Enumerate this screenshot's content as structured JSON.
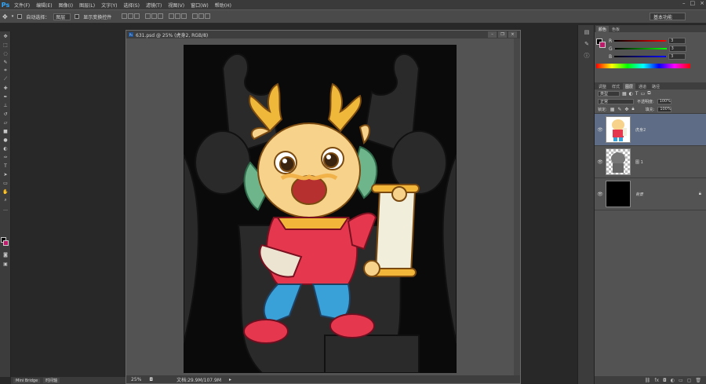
{
  "menubar": {
    "app_logo": "Ps",
    "items": [
      "文件(F)",
      "编辑(E)",
      "图像(I)",
      "图层(L)",
      "文字(Y)",
      "选择(S)",
      "滤镜(T)",
      "视图(V)",
      "窗口(W)",
      "帮助(H)"
    ],
    "controls": [
      "–",
      "□",
      "×"
    ]
  },
  "options": {
    "auto_select_label": "自动选择：",
    "auto_select_value": "图层",
    "transform_label": "显示变换控件",
    "workspace": "基本功能"
  },
  "document": {
    "title": "631.psd @ 25% (虎身2, RGB/8)",
    "zoom": "25%",
    "doc_size": "文档:29.9M/107.9M"
  },
  "mini_bridge": {
    "tabs": [
      "Mini Bridge",
      "时间轴"
    ]
  },
  "color_panel": {
    "tabs": [
      "颜色",
      "色板"
    ],
    "channels": [
      {
        "label": "R",
        "value": "3",
        "color": "#ff3b3b"
      },
      {
        "label": "G",
        "value": "3",
        "color": "#3bd03b"
      },
      {
        "label": "B",
        "value": "3",
        "color": "#3b6bff"
      }
    ],
    "fg_color": "#000000",
    "bg_color": "#c0186a"
  },
  "layers_panel": {
    "tabs": [
      "调整",
      "样式",
      "图层",
      "通道",
      "路径"
    ],
    "active_tab": "图层",
    "filter_type": "类型",
    "blend_mode": "正常",
    "opacity_label": "不透明度:",
    "opacity_value": "100%",
    "lock_label": "锁定:",
    "fill_label": "填充:",
    "fill_value": "100%",
    "layers": [
      {
        "name": "虎身2",
        "selected": true
      },
      {
        "name": "图 1",
        "selected": false
      },
      {
        "name": "背景",
        "selected": false
      }
    ]
  }
}
